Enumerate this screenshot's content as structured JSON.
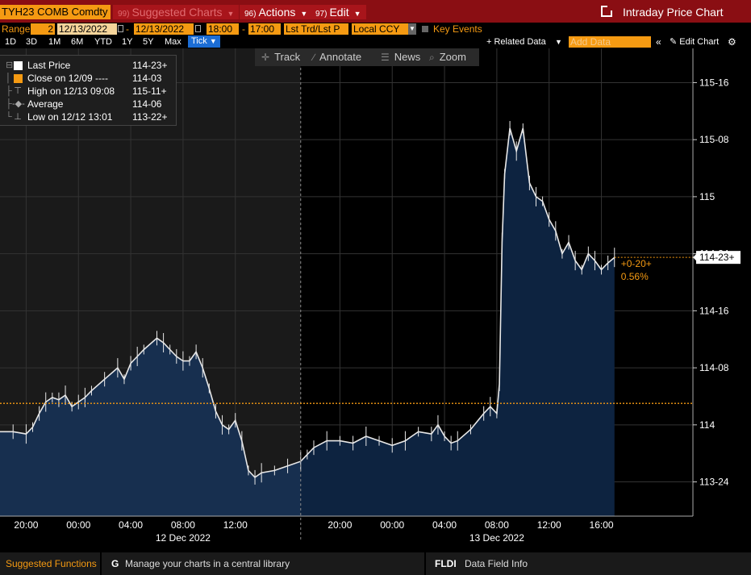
{
  "header": {
    "ticker": "TYH23 COMB Comdty",
    "menus": [
      {
        "num": "99)",
        "label": "Suggested Charts"
      },
      {
        "num": "96)",
        "label": "Actions"
      },
      {
        "num": "97)",
        "label": "Edit"
      }
    ],
    "title": "Intraday Price Chart"
  },
  "range_row": {
    "range_label": "Range",
    "range_value": "2",
    "start_date": "12/13/2022",
    "end_date": "12/13/2022",
    "start_time": "18:00",
    "end_time": "17:00",
    "price_type": "Lst Trd/Lst P",
    "currency": "Local CCY",
    "key_events": "Key Events"
  },
  "period_row": {
    "periods": [
      "1D",
      "3D",
      "1M",
      "6M",
      "YTD",
      "1Y",
      "5Y",
      "Max"
    ],
    "active": "Tick",
    "related_data": "+ Related Data",
    "add_data_placeholder": "Add Data",
    "collapse": "«",
    "edit_chart": "Edit Chart",
    "gear": "⚙"
  },
  "toolbar": {
    "track": "Track",
    "annotate": "Annotate",
    "news": "News",
    "zoom": "Zoom"
  },
  "legend": [
    {
      "label": "Last Price",
      "value": "114-23+"
    },
    {
      "label": "Close on 12/09 ----",
      "value": "114-03"
    },
    {
      "label": "High on 12/13 09:08",
      "value": "115-11+"
    },
    {
      "label": "Average",
      "value": "114-06"
    },
    {
      "label": "Low on 12/12 13:01",
      "value": "113-22+"
    }
  ],
  "colors": {
    "accent": "#f59a12",
    "header_red": "#8a0e13",
    "area_fill": "#172f4f",
    "area_fill_today": "#0d2340",
    "bg_day1": "#1a1a1a",
    "bg_day2": "#000000"
  },
  "chart_data": {
    "type": "area",
    "y_unit": "32nds of a point",
    "yticks": [
      "115-16",
      "115-08",
      "115",
      "114-24",
      "114-16",
      "114-08",
      "114",
      "113-24"
    ],
    "ytick_values": [
      115.5,
      115.25,
      115.0,
      114.75,
      114.5,
      114.25,
      114.0,
      113.75
    ],
    "ylim": [
      113.6,
      115.65
    ],
    "xticks": [
      "20:00",
      "00:00",
      "04:00",
      "08:00",
      "12:00",
      "20:00",
      "00:00",
      "04:00",
      "08:00",
      "12:00",
      "16:00"
    ],
    "xtick_hours": [
      -4,
      0,
      4,
      8,
      12,
      20,
      24,
      28,
      32,
      36,
      40
    ],
    "xlim": [
      -6,
      47
    ],
    "session_break_hour": 17,
    "x_date_labels": [
      {
        "label": "12 Dec 2022",
        "hour": 8
      },
      {
        "label": "13 Dec 2022",
        "hour": 32
      }
    ],
    "last_price_label": "114-23+",
    "last_price": 114.734,
    "prev_close": 114.094,
    "change_label": "+0-20+",
    "change_pct": "0.56%",
    "series": [
      {
        "name": "Last Price",
        "x": [
          -6,
          -5,
          -4,
          -3.5,
          -3,
          -2.5,
          -2,
          -1.5,
          -1,
          -0.5,
          0,
          0.5,
          1,
          2,
          3,
          3.5,
          4,
          4.5,
          5,
          6,
          6.5,
          7,
          7.5,
          8,
          8.5,
          9,
          9.5,
          10,
          10.5,
          11,
          11.5,
          12,
          12.5,
          13,
          13.5,
          14,
          15,
          16,
          17,
          17.5,
          18,
          19,
          20,
          21,
          22,
          23,
          24,
          25,
          26,
          27,
          27.5,
          28,
          28.5,
          29,
          30,
          31,
          31.5,
          32,
          32.2,
          32.4,
          32.6,
          33,
          33.5,
          34,
          34.5,
          35,
          35.5,
          36,
          36.5,
          37,
          37.5,
          38,
          38.5,
          39,
          39.5,
          40,
          40.5,
          41
        ],
        "y": [
          113.97,
          113.97,
          113.96,
          113.99,
          114.05,
          114.1,
          114.12,
          114.11,
          114.13,
          114.08,
          114.1,
          114.12,
          114.15,
          114.2,
          114.25,
          114.2,
          114.27,
          114.3,
          114.33,
          114.38,
          114.36,
          114.33,
          114.3,
          114.28,
          114.28,
          114.32,
          114.25,
          114.16,
          114.06,
          114.0,
          113.98,
          114.02,
          113.93,
          113.8,
          113.77,
          113.79,
          113.8,
          113.82,
          113.84,
          113.87,
          113.9,
          113.93,
          113.93,
          113.92,
          113.95,
          113.93,
          113.91,
          113.93,
          113.97,
          113.96,
          114.0,
          113.95,
          113.92,
          113.93,
          113.98,
          114.05,
          114.08,
          114.05,
          114.18,
          114.8,
          115.1,
          115.3,
          115.2,
          115.3,
          115.06,
          115.0,
          114.98,
          114.9,
          114.85,
          114.75,
          114.8,
          114.72,
          114.68,
          114.75,
          114.72,
          114.68,
          114.71,
          114.734
        ]
      }
    ]
  },
  "bottom": {
    "suggested": "Suggested Functions",
    "g_key": "G",
    "g_text": "Manage your charts in a central library",
    "fldi_key": "FLDI",
    "fldi_text": "Data Field Info"
  }
}
